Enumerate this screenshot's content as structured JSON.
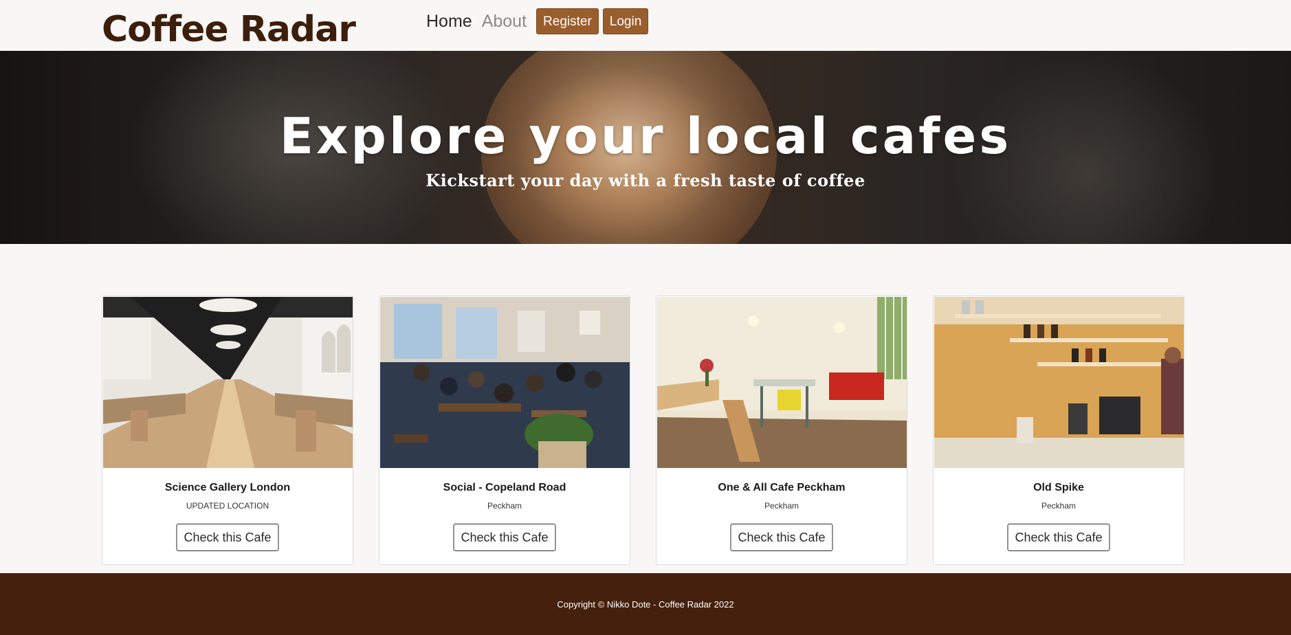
{
  "navbar": {
    "brand": "Coffee Radar",
    "links": {
      "home": "Home",
      "about": "About"
    },
    "buttons": {
      "register": "Register",
      "login": "Login"
    }
  },
  "hero": {
    "title": "Explore your local cafes",
    "subtitle": "Kickstart your day with a fresh taste of coffee"
  },
  "cafes": [
    {
      "name": "Science Gallery London",
      "location": "UPDATED LOCATION",
      "button": "Check this Cafe"
    },
    {
      "name": "Social - Copeland Road",
      "location": "Peckham",
      "button": "Check this Cafe"
    },
    {
      "name": "One & All Cafe Peckham",
      "location": "Peckham",
      "button": "Check this Cafe"
    },
    {
      "name": "Old Spike",
      "location": "Peckham",
      "button": "Check this Cafe"
    }
  ],
  "footer": {
    "copyright": "Copyright © Nikko Dote - Coffee Radar 2022"
  },
  "colors": {
    "brand_text": "#3b1e0b",
    "button_brown": "#9a5d2c",
    "footer_bg": "#45200c",
    "page_bg": "#f9f7f5"
  }
}
